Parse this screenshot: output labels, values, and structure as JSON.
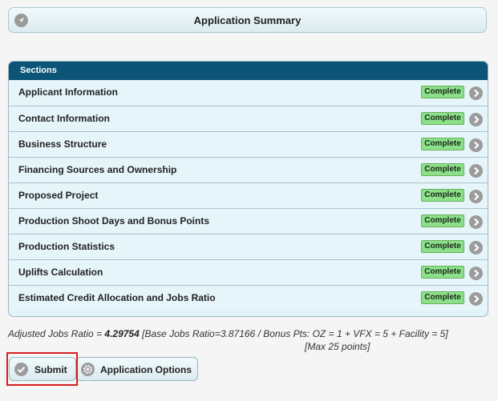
{
  "summary": {
    "title": "Application Summary"
  },
  "sections": {
    "header": "Sections",
    "items": [
      {
        "label": "Applicant Information",
        "status": "Complete"
      },
      {
        "label": "Contact Information",
        "status": "Complete"
      },
      {
        "label": "Business Structure",
        "status": "Complete"
      },
      {
        "label": "Financing Sources and Ownership",
        "status": "Complete"
      },
      {
        "label": "Proposed Project",
        "status": "Complete"
      },
      {
        "label": "Production Shoot Days and Bonus Points",
        "status": "Complete"
      },
      {
        "label": "Production Statistics",
        "status": "Complete"
      },
      {
        "label": "Uplifts Calculation",
        "status": "Complete"
      },
      {
        "label": "Estimated Credit Allocation and Jobs Ratio",
        "status": "Complete"
      }
    ]
  },
  "jobs": {
    "prefix": "Adjusted Jobs Ratio = ",
    "value": "4.29754",
    "detail": " [Base Jobs Ratio=3.87166 / Bonus Pts: OZ = 1 + VFX = 5 + Facility = 5]",
    "max": "[Max 25 points]"
  },
  "actions": {
    "submit_label": "Submit",
    "options_label": "Application Options"
  },
  "colors": {
    "header_bg": "#0d5479",
    "badge_bg": "#8de08a",
    "highlight": "#d62020"
  }
}
